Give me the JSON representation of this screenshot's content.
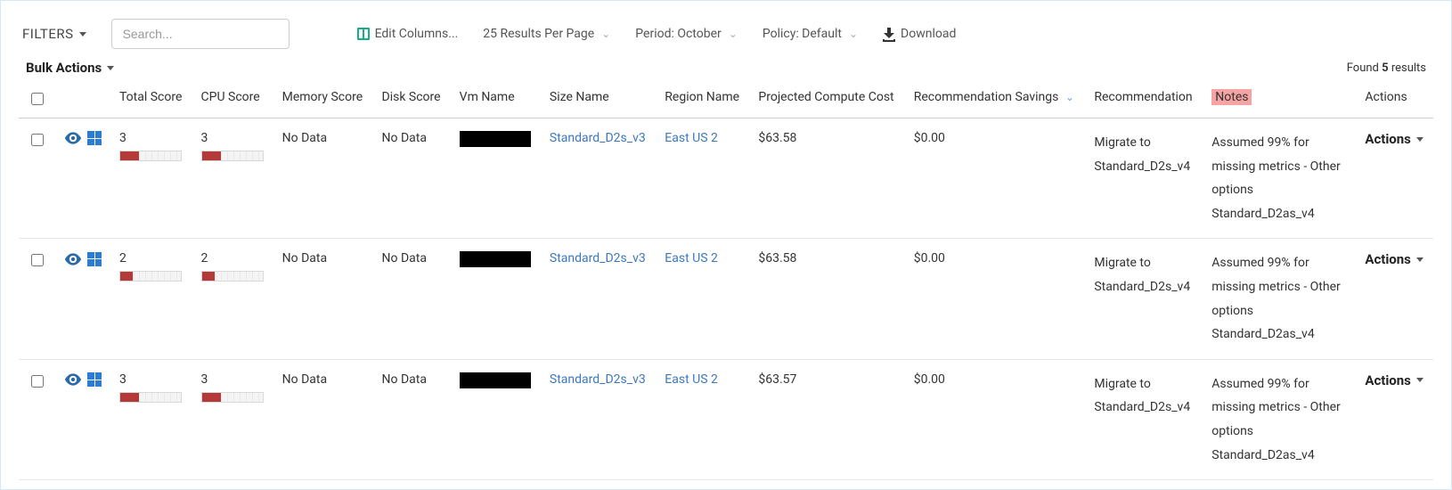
{
  "toolbar": {
    "filters_label": "FILTERS",
    "search_placeholder": "Search...",
    "edit_columns_label": "Edit Columns...",
    "results_per_page_label": "25 Results Per Page",
    "period_label": "Period: October",
    "policy_label": "Policy: Default",
    "download_label": "Download"
  },
  "subbar": {
    "bulk_actions_label": "Bulk Actions",
    "found_prefix": "Found ",
    "found_count": "5",
    "found_suffix": " results"
  },
  "headers": {
    "total_score": "Total Score",
    "cpu_score": "CPU Score",
    "memory_score": "Memory Score",
    "disk_score": "Disk Score",
    "vm_name": "Vm Name",
    "size_name": "Size Name",
    "region_name": "Region Name",
    "projected_cost": "Projected Compute Cost",
    "recommendation_savings": "Recommendation Savings",
    "recommendation": "Recommendation",
    "notes": "Notes",
    "actions": "Actions"
  },
  "rows": [
    {
      "total_score": "3",
      "cpu_score": "3",
      "memory_score": "No Data",
      "disk_score": "No Data",
      "size_name": "Standard_D2s_v3",
      "region_name": "East US 2",
      "projected_cost": "$63.58",
      "savings": "$0.00",
      "recommendation": "Migrate to Standard_D2s_v4",
      "notes": "Assumed 99% for missing metrics - Other options Standard_D2as_v4",
      "actions_label": "Actions"
    },
    {
      "total_score": "2",
      "cpu_score": "2",
      "memory_score": "No Data",
      "disk_score": "No Data",
      "size_name": "Standard_D2s_v3",
      "region_name": "East US 2",
      "projected_cost": "$63.58",
      "savings": "$0.00",
      "recommendation": "Migrate to Standard_D2s_v4",
      "notes": "Assumed 99% for missing metrics - Other options Standard_D2as_v4",
      "actions_label": "Actions"
    },
    {
      "total_score": "3",
      "cpu_score": "3",
      "memory_score": "No Data",
      "disk_score": "No Data",
      "size_name": "Standard_D2s_v3",
      "region_name": "East US 2",
      "projected_cost": "$63.57",
      "savings": "$0.00",
      "recommendation": "Migrate to Standard_D2s_v4",
      "notes": "Assumed 99% for missing metrics - Other options Standard_D2as_v4",
      "actions_label": "Actions"
    }
  ]
}
